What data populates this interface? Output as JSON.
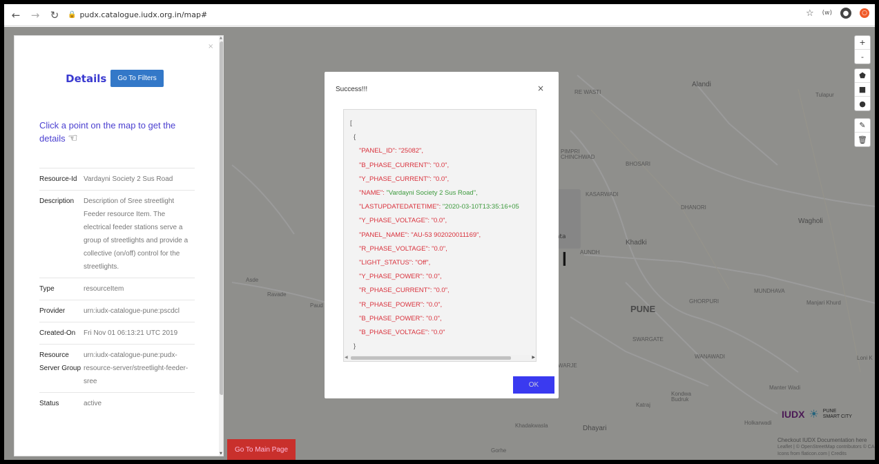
{
  "browser": {
    "url": "pudx.catalogue.iudx.org.in/map#",
    "back_icon": "arrow-left",
    "forward_icon": "arrow-right",
    "reload_icon": "reload",
    "lock_icon": "lock",
    "star_icon": "star",
    "incognito_label": "(w)"
  },
  "map_labels": [
    {
      "text": "Alandi",
      "cls": "med"
    },
    {
      "text": "Tulapur",
      "cls": ""
    },
    {
      "text": "RE WASTI",
      "cls": ""
    },
    {
      "text": "PIMPRI CHINCHWAD",
      "cls": ""
    },
    {
      "text": "BHOSARI",
      "cls": ""
    },
    {
      "text": "KASARWADI",
      "cls": ""
    },
    {
      "text": "DHANORI",
      "cls": ""
    },
    {
      "text": "Wagholi",
      "cls": "med"
    },
    {
      "text": "Khadki",
      "cls": "med"
    },
    {
      "text": "AUNDH",
      "cls": ""
    },
    {
      "text": "Asde",
      "cls": ""
    },
    {
      "text": "Ravade",
      "cls": ""
    },
    {
      "text": "Paud",
      "cls": ""
    },
    {
      "text": "PUNE",
      "cls": "big"
    },
    {
      "text": "GHORPURI",
      "cls": ""
    },
    {
      "text": "MUNDHAVA",
      "cls": ""
    },
    {
      "text": "Manjari Khurd",
      "cls": ""
    },
    {
      "text": "SWARGATE",
      "cls": ""
    },
    {
      "text": "WANAWADI",
      "cls": ""
    },
    {
      "text": "Loni K",
      "cls": ""
    },
    {
      "text": "WARJE",
      "cls": ""
    },
    {
      "text": "Manter Wadi",
      "cls": ""
    },
    {
      "text": "Kondwa Budruk",
      "cls": ""
    },
    {
      "text": "Katraj",
      "cls": ""
    },
    {
      "text": "Khadakwasla",
      "cls": ""
    },
    {
      "text": "Dhayari",
      "cls": "med"
    },
    {
      "text": "Holkarwadi",
      "cls": ""
    },
    {
      "text": "Gorhe",
      "cls": ""
    }
  ],
  "map_controls": {
    "zoom_in": "+",
    "zoom_out": "-",
    "polygon_icon": "pentagon",
    "rect_icon": "square",
    "circle_icon": "circle",
    "edit_icon": "edit",
    "trash_icon": "trash"
  },
  "panel": {
    "close": "×",
    "title": "Details",
    "filters_button": "Go To Filters",
    "hint": "Click a point on the map to get the details",
    "details": [
      {
        "key": "Resource-Id",
        "value": "Vardayni Society 2 Sus Road"
      },
      {
        "key": "Description",
        "value": "Description of Sree streetlight Feeder resource Item. The electrical feeder stations serve a group of streetlights and provide a collective (on/off) control for the streetlights."
      },
      {
        "key": "Type",
        "value": "resourceItem"
      },
      {
        "key": "Provider",
        "value": "urn:iudx-catalogue-pune:pscdcl"
      },
      {
        "key": "Created-On",
        "value": "Fri Nov 01 06:13:21 UTC 2019"
      },
      {
        "key": "Resource Server Group",
        "value": "urn:iudx-catalogue-pune:pudx-resource-server/streetlight-feeder-sree"
      },
      {
        "key": "Status",
        "value": "active"
      }
    ]
  },
  "main_page_button": "Go To Main Page",
  "popup_behind_text": "ata",
  "logos": {
    "iudx": "IUDX",
    "psc": "PUNE SMART CITY"
  },
  "attribution": {
    "line1": "Checkout IUDX Documentation here",
    "line2": "Leaflet | © OpenStreetMap contributors © CARTO",
    "line3": "Icons from flaticon.com | Credits"
  },
  "modal": {
    "title": "Success!!!",
    "close": "×",
    "open_bracket": "[",
    "open_brace": "{",
    "close_brace": "}",
    "close_bracket": "]",
    "entries": [
      {
        "key": "\"PANEL_ID\":",
        "value": " \"25082\","
      },
      {
        "key": "\"B_PHASE_CURRENT\":",
        "value": " \"0.0\","
      },
      {
        "key": "\"Y_PHASE_CURRENT\":",
        "value": " \"0.0\","
      },
      {
        "key": "\"NAME\":",
        "value": " \"Vardayni Society 2 Sus Road\","
      },
      {
        "key": "\"LASTUPDATEDATETIME\":",
        "value": " \"2020-03-10T13:35:16+05"
      },
      {
        "key": "\"Y_PHASE_VOLTAGE\":",
        "value": " \"0.0\","
      },
      {
        "key": "\"PANEL_NAME\":",
        "value": " \"AU-53 902020011169\","
      },
      {
        "key": "\"R_PHASE_VOLTAGE\":",
        "value": " \"0.0\","
      },
      {
        "key": "\"LIGHT_STATUS\":",
        "value": " \"Off\","
      },
      {
        "key": "\"Y_PHASE_POWER\":",
        "value": " \"0.0\","
      },
      {
        "key": "\"R_PHASE_CURRENT\":",
        "value": " \"0.0\","
      },
      {
        "key": "\"R_PHASE_POWER\":",
        "value": " \"0.0\","
      },
      {
        "key": "\"B_PHASE_POWER\":",
        "value": " \"0.0\","
      },
      {
        "key": "\"B_PHASE_VOLTAGE\":",
        "value": " \"0.0\""
      }
    ],
    "ok_button": "OK"
  },
  "colors": {
    "accent_blue": "#3378c8",
    "title_purple": "#3a3ad0",
    "danger_red": "#c9302c",
    "json_key": "#d9313c",
    "json_value": "#3d9a3d",
    "ok_blue": "#3a3af0"
  }
}
